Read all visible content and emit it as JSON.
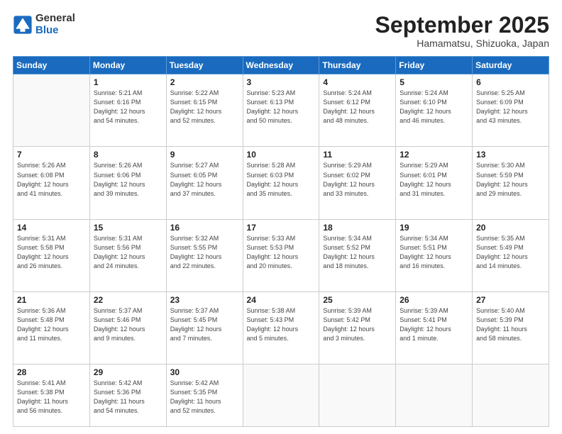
{
  "header": {
    "logo_general": "General",
    "logo_blue": "Blue",
    "month_title": "September 2025",
    "subtitle": "Hamamatsu, Shizuoka, Japan"
  },
  "weekdays": [
    "Sunday",
    "Monday",
    "Tuesday",
    "Wednesday",
    "Thursday",
    "Friday",
    "Saturday"
  ],
  "weeks": [
    [
      {
        "day": "",
        "info": ""
      },
      {
        "day": "1",
        "info": "Sunrise: 5:21 AM\nSunset: 6:16 PM\nDaylight: 12 hours\nand 54 minutes."
      },
      {
        "day": "2",
        "info": "Sunrise: 5:22 AM\nSunset: 6:15 PM\nDaylight: 12 hours\nand 52 minutes."
      },
      {
        "day": "3",
        "info": "Sunrise: 5:23 AM\nSunset: 6:13 PM\nDaylight: 12 hours\nand 50 minutes."
      },
      {
        "day": "4",
        "info": "Sunrise: 5:24 AM\nSunset: 6:12 PM\nDaylight: 12 hours\nand 48 minutes."
      },
      {
        "day": "5",
        "info": "Sunrise: 5:24 AM\nSunset: 6:10 PM\nDaylight: 12 hours\nand 46 minutes."
      },
      {
        "day": "6",
        "info": "Sunrise: 5:25 AM\nSunset: 6:09 PM\nDaylight: 12 hours\nand 43 minutes."
      }
    ],
    [
      {
        "day": "7",
        "info": "Sunrise: 5:26 AM\nSunset: 6:08 PM\nDaylight: 12 hours\nand 41 minutes."
      },
      {
        "day": "8",
        "info": "Sunrise: 5:26 AM\nSunset: 6:06 PM\nDaylight: 12 hours\nand 39 minutes."
      },
      {
        "day": "9",
        "info": "Sunrise: 5:27 AM\nSunset: 6:05 PM\nDaylight: 12 hours\nand 37 minutes."
      },
      {
        "day": "10",
        "info": "Sunrise: 5:28 AM\nSunset: 6:03 PM\nDaylight: 12 hours\nand 35 minutes."
      },
      {
        "day": "11",
        "info": "Sunrise: 5:29 AM\nSunset: 6:02 PM\nDaylight: 12 hours\nand 33 minutes."
      },
      {
        "day": "12",
        "info": "Sunrise: 5:29 AM\nSunset: 6:01 PM\nDaylight: 12 hours\nand 31 minutes."
      },
      {
        "day": "13",
        "info": "Sunrise: 5:30 AM\nSunset: 5:59 PM\nDaylight: 12 hours\nand 29 minutes."
      }
    ],
    [
      {
        "day": "14",
        "info": "Sunrise: 5:31 AM\nSunset: 5:58 PM\nDaylight: 12 hours\nand 26 minutes."
      },
      {
        "day": "15",
        "info": "Sunrise: 5:31 AM\nSunset: 5:56 PM\nDaylight: 12 hours\nand 24 minutes."
      },
      {
        "day": "16",
        "info": "Sunrise: 5:32 AM\nSunset: 5:55 PM\nDaylight: 12 hours\nand 22 minutes."
      },
      {
        "day": "17",
        "info": "Sunrise: 5:33 AM\nSunset: 5:53 PM\nDaylight: 12 hours\nand 20 minutes."
      },
      {
        "day": "18",
        "info": "Sunrise: 5:34 AM\nSunset: 5:52 PM\nDaylight: 12 hours\nand 18 minutes."
      },
      {
        "day": "19",
        "info": "Sunrise: 5:34 AM\nSunset: 5:51 PM\nDaylight: 12 hours\nand 16 minutes."
      },
      {
        "day": "20",
        "info": "Sunrise: 5:35 AM\nSunset: 5:49 PM\nDaylight: 12 hours\nand 14 minutes."
      }
    ],
    [
      {
        "day": "21",
        "info": "Sunrise: 5:36 AM\nSunset: 5:48 PM\nDaylight: 12 hours\nand 11 minutes."
      },
      {
        "day": "22",
        "info": "Sunrise: 5:37 AM\nSunset: 5:46 PM\nDaylight: 12 hours\nand 9 minutes."
      },
      {
        "day": "23",
        "info": "Sunrise: 5:37 AM\nSunset: 5:45 PM\nDaylight: 12 hours\nand 7 minutes."
      },
      {
        "day": "24",
        "info": "Sunrise: 5:38 AM\nSunset: 5:43 PM\nDaylight: 12 hours\nand 5 minutes."
      },
      {
        "day": "25",
        "info": "Sunrise: 5:39 AM\nSunset: 5:42 PM\nDaylight: 12 hours\nand 3 minutes."
      },
      {
        "day": "26",
        "info": "Sunrise: 5:39 AM\nSunset: 5:41 PM\nDaylight: 12 hours\nand 1 minute."
      },
      {
        "day": "27",
        "info": "Sunrise: 5:40 AM\nSunset: 5:39 PM\nDaylight: 11 hours\nand 58 minutes."
      }
    ],
    [
      {
        "day": "28",
        "info": "Sunrise: 5:41 AM\nSunset: 5:38 PM\nDaylight: 11 hours\nand 56 minutes."
      },
      {
        "day": "29",
        "info": "Sunrise: 5:42 AM\nSunset: 5:36 PM\nDaylight: 11 hours\nand 54 minutes."
      },
      {
        "day": "30",
        "info": "Sunrise: 5:42 AM\nSunset: 5:35 PM\nDaylight: 11 hours\nand 52 minutes."
      },
      {
        "day": "",
        "info": ""
      },
      {
        "day": "",
        "info": ""
      },
      {
        "day": "",
        "info": ""
      },
      {
        "day": "",
        "info": ""
      }
    ]
  ]
}
